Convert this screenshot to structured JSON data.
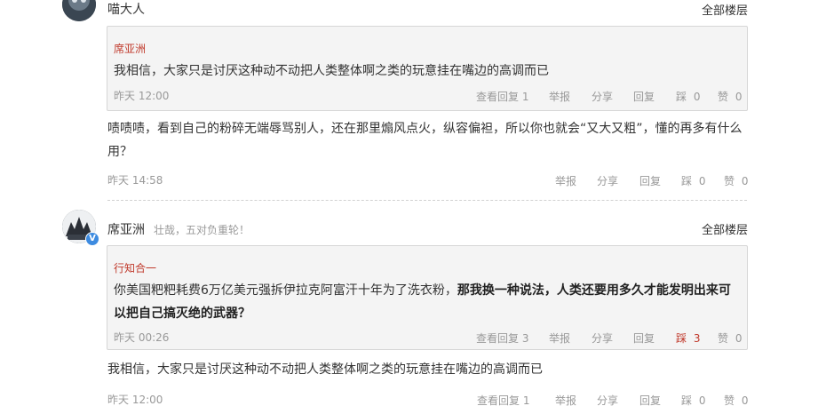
{
  "comments": [
    {
      "username": "喵大人",
      "all_floors": "全部楼层",
      "quote": {
        "author": "席亚洲",
        "text": "我相信，大家只是讨厌这种动不动把人类整体啊之类的玩意挂在嘴边的高调而已",
        "time": "昨天 12:00",
        "view_replies": "查看回复 1",
        "report": "举报",
        "share": "分享",
        "reply": "回复",
        "dislike": "踩",
        "dislike_count": "0",
        "like": "赞",
        "like_count": "0"
      },
      "body": "啧啧啧，看到自己的粉碎无端辱骂别人，还在那里煽风点火，纵容偏袒，所以你也就会“又大又粗”，懂的再多有什么用？",
      "time": "昨天 14:58",
      "report": "举报",
      "share": "分享",
      "reply": "回复",
      "dislike": "踩",
      "dislike_count": "0",
      "like": "赞",
      "like_count": "0"
    },
    {
      "username": "席亚洲",
      "motto": "壮哉，五对负重轮！",
      "verified_badge": "V",
      "all_floors": "全部楼层",
      "quote": {
        "author": "行知合一",
        "text_normal": "你美国粑粑耗费6万亿美元强拆伊拉克阿富汗十年为了洗衣粉，",
        "text_bold": "那我换一种说法，人类还要用多久才能发明出来可以把自己搞灭绝的武器？",
        "time": "昨天 00:26",
        "view_replies": "查看回复 3",
        "report": "举报",
        "share": "分享",
        "reply": "回复",
        "dislike": "踩",
        "dislike_count": "3",
        "like": "赞",
        "like_count": "0"
      },
      "body": "我相信，大家只是讨厌这种动不动把人类整体啊之类的玩意挂在嘴边的高调而已",
      "time": "昨天 12:00",
      "view_replies": "查看回复 1",
      "report": "举报",
      "share": "分享",
      "reply": "回复",
      "dislike": "踩",
      "dislike_count": "0",
      "like": "赞",
      "like_count": "0"
    }
  ],
  "colors": {
    "accent_red": "#c0392b",
    "verified_blue": "#3d8be0",
    "muted": "#999999"
  }
}
